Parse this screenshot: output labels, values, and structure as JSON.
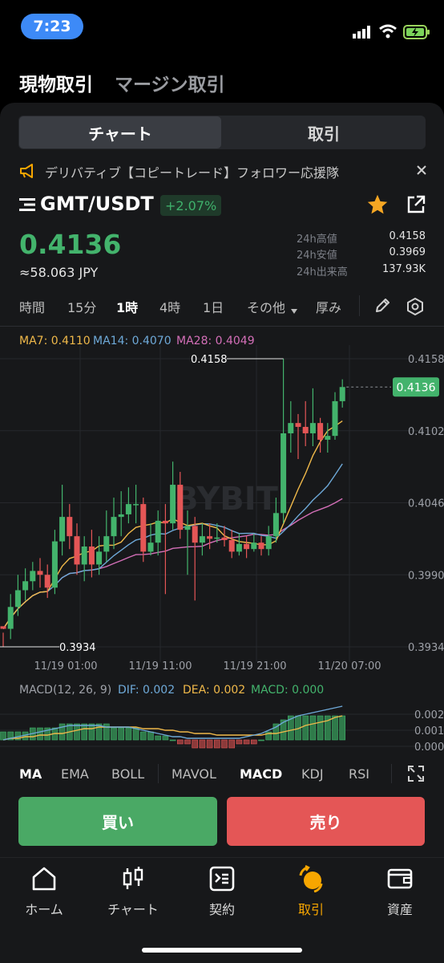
{
  "status": {
    "time": "7:23"
  },
  "top_tabs": {
    "spot": "現物取引",
    "margin": "マージン取引"
  },
  "segment": {
    "chart": "チャート",
    "trade": "取引"
  },
  "notice": {
    "text": "デリバティブ【コピートレード】フォロワー応援隊"
  },
  "ticker": {
    "pair": "GMT/USDT",
    "change": "+2.07%",
    "price": "0.4136",
    "price_jpy": "≈58.063 JPY",
    "stats": [
      {
        "label": "24h高値",
        "value": "0.4158"
      },
      {
        "label": "24h安値",
        "value": "0.3969"
      },
      {
        "label": "24h出来高",
        "value": "137.93K"
      }
    ]
  },
  "timeframes": [
    "時間",
    "15分",
    "1時",
    "4時",
    "1日",
    "その他",
    "厚み"
  ],
  "active_timeframe": "1時",
  "ma_legend": {
    "ma7": "MA7: 0.4110",
    "ma14": "MA14: 0.4070",
    "ma28": "MA28: 0.4049"
  },
  "watermark": "BYBIT",
  "colors": {
    "up": "#43b36c",
    "down": "#e45656",
    "ma7": "#f0b94a",
    "ma14": "#6ea9d8",
    "ma28": "#d46fb8",
    "accent": "#f7a600",
    "buy": "#4aa965",
    "sell": "#e45656"
  },
  "chart_data": {
    "type": "candlestick",
    "x_ticks": [
      "11/19 01:00",
      "11/19 11:00",
      "11/19 21:00",
      "11/20 07:00"
    ],
    "y_ticks": [
      "0.4158",
      "0.4102",
      "0.4046",
      "0.3990",
      "0.3934"
    ],
    "ylim": [
      0.3934,
      0.4158
    ],
    "high_marker": "0.4158",
    "low_marker": "0.3934",
    "last_price": "0.4136",
    "candles": [
      [
        0.395,
        0.3948,
        0.3945,
        0.3934
      ],
      [
        0.3948,
        0.3965,
        0.3975,
        0.394
      ],
      [
        0.3965,
        0.3978,
        0.399,
        0.3958
      ],
      [
        0.3978,
        0.3985,
        0.3995,
        0.397
      ],
      [
        0.3985,
        0.3993,
        0.4,
        0.3978
      ],
      [
        0.3993,
        0.399,
        0.4003,
        0.398
      ],
      [
        0.399,
        0.398,
        0.3998,
        0.3972
      ],
      [
        0.398,
        0.4016,
        0.4025,
        0.3975
      ],
      [
        0.4016,
        0.4035,
        0.406,
        0.4005
      ],
      [
        0.4035,
        0.402,
        0.4045,
        0.401
      ],
      [
        0.402,
        0.3998,
        0.403,
        0.399
      ],
      [
        0.3998,
        0.4012,
        0.402,
        0.3985
      ],
      [
        0.4012,
        0.3998,
        0.4025,
        0.3988
      ],
      [
        0.3998,
        0.4008,
        0.402,
        0.399
      ],
      [
        0.4008,
        0.402,
        0.404,
        0.4
      ],
      [
        0.402,
        0.4035,
        0.405,
        0.401
      ],
      [
        0.4035,
        0.4037,
        0.4055,
        0.402
      ],
      [
        0.4037,
        0.4045,
        0.4058,
        0.403
      ],
      [
        0.4045,
        0.4045,
        0.406,
        0.403
      ],
      [
        0.4045,
        0.4008,
        0.405,
        0.4
      ],
      [
        0.4008,
        0.4015,
        0.403,
        0.4005
      ],
      [
        0.4015,
        0.4032,
        0.404,
        0.4005
      ],
      [
        0.4032,
        0.403,
        0.4045,
        0.3975
      ],
      [
        0.403,
        0.406,
        0.4078,
        0.4025
      ],
      [
        0.406,
        0.4025,
        0.407,
        0.4018
      ],
      [
        0.4025,
        0.4028,
        0.404,
        0.399
      ],
      [
        0.4028,
        0.4015,
        0.4035,
        0.397
      ],
      [
        0.4015,
        0.402,
        0.403,
        0.4005
      ],
      [
        0.402,
        0.4018,
        0.403,
        0.401
      ],
      [
        0.4018,
        0.4019,
        0.403,
        0.4015
      ],
      [
        0.4019,
        0.4017,
        0.4028,
        0.4012
      ],
      [
        0.4017,
        0.4008,
        0.4025,
        0.4003
      ],
      [
        0.4008,
        0.4014,
        0.4022,
        0.4005
      ],
      [
        0.4014,
        0.401,
        0.402,
        0.4003
      ],
      [
        0.401,
        0.4015,
        0.4022,
        0.4008
      ],
      [
        0.4015,
        0.401,
        0.402,
        0.4005
      ],
      [
        0.401,
        0.402,
        0.4028,
        0.4005
      ],
      [
        0.402,
        0.4038,
        0.405,
        0.4015
      ],
      [
        0.4038,
        0.41,
        0.4158,
        0.403
      ],
      [
        0.41,
        0.4108,
        0.4125,
        0.4085
      ],
      [
        0.4108,
        0.4105,
        0.4115,
        0.408
      ],
      [
        0.4105,
        0.41,
        0.4125,
        0.409
      ],
      [
        0.41,
        0.4108,
        0.4135,
        0.409
      ],
      [
        0.4108,
        0.4095,
        0.4112,
        0.4085
      ],
      [
        0.4095,
        0.4098,
        0.4108,
        0.4085
      ],
      [
        0.4098,
        0.4125,
        0.4132,
        0.4095
      ],
      [
        0.4125,
        0.4136,
        0.4142,
        0.412
      ]
    ],
    "macd_label": "MACD(12, 26, 9)",
    "dif_label": "DIF: 0.002",
    "dea_label": "DEA: 0.002",
    "macd_val_label": "MACD: 0.000",
    "macd_y_ticks": [
      "0.002",
      "0.001",
      "0.000"
    ],
    "macd_hist": [
      0.0002,
      0.0002,
      0.0002,
      0.0002,
      0.0003,
      0.0003,
      0.0003,
      0.0003,
      0.0004,
      0.0004,
      0.0004,
      0.0004,
      0.0004,
      0.0004,
      0.0004,
      0.0003,
      0.0003,
      0.0003,
      0.0003,
      0.0002,
      0.0002,
      0.0001,
      0.0001,
      0.0,
      -0.0001,
      -0.0001,
      -0.0002,
      -0.0002,
      -0.0002,
      -0.0002,
      -0.0002,
      -0.0002,
      -0.0001,
      -0.0001,
      -0.0001,
      0.0,
      0.0002,
      0.0004,
      0.0005,
      0.0006,
      0.0006,
      0.0006,
      0.0006,
      0.0006,
      0.0006,
      0.0006,
      0.0006
    ],
    "dif": [
      0.0,
      0.0001,
      0.0002,
      0.0003,
      0.0004,
      0.0005,
      0.0006,
      0.0007,
      0.0008,
      0.0009,
      0.0009,
      0.0009,
      0.0009,
      0.0009,
      0.0008,
      0.0008,
      0.0008,
      0.0008,
      0.0007,
      0.0006,
      0.0005,
      0.0004,
      0.0003,
      0.0002,
      0.0002,
      0.0001,
      0.0001,
      0.0001,
      0.0001,
      0.0001,
      0.0001,
      0.0001,
      0.0001,
      0.0002,
      0.0003,
      0.0004,
      0.0006,
      0.0008,
      0.0011,
      0.0013,
      0.0015,
      0.0016,
      0.0017,
      0.0018,
      0.0019,
      0.002,
      0.0021
    ],
    "dea": [
      0.0,
      0.0001,
      0.0001,
      0.0002,
      0.0002,
      0.0003,
      0.0003,
      0.0004,
      0.0004,
      0.0005,
      0.0006,
      0.0007,
      0.0007,
      0.0008,
      0.0008,
      0.0008,
      0.0008,
      0.0008,
      0.0008,
      0.0007,
      0.0007,
      0.0007,
      0.0006,
      0.0006,
      0.0005,
      0.0005,
      0.0004,
      0.0004,
      0.0004,
      0.0003,
      0.0003,
      0.0003,
      0.0003,
      0.0003,
      0.0003,
      0.0003,
      0.0004,
      0.0004,
      0.0005,
      0.0006,
      0.0007,
      0.0009,
      0.001,
      0.0011,
      0.0012,
      0.0014,
      0.0015
    ]
  },
  "indicator_tabs": [
    "MA",
    "EMA",
    "BOLL",
    "MAVOL",
    "MACD",
    "KDJ",
    "RSI"
  ],
  "actions": {
    "buy": "買い",
    "sell": "売り"
  },
  "nav": [
    "ホーム",
    "チャート",
    "契約",
    "取引",
    "資産"
  ],
  "nav_active": "取引"
}
